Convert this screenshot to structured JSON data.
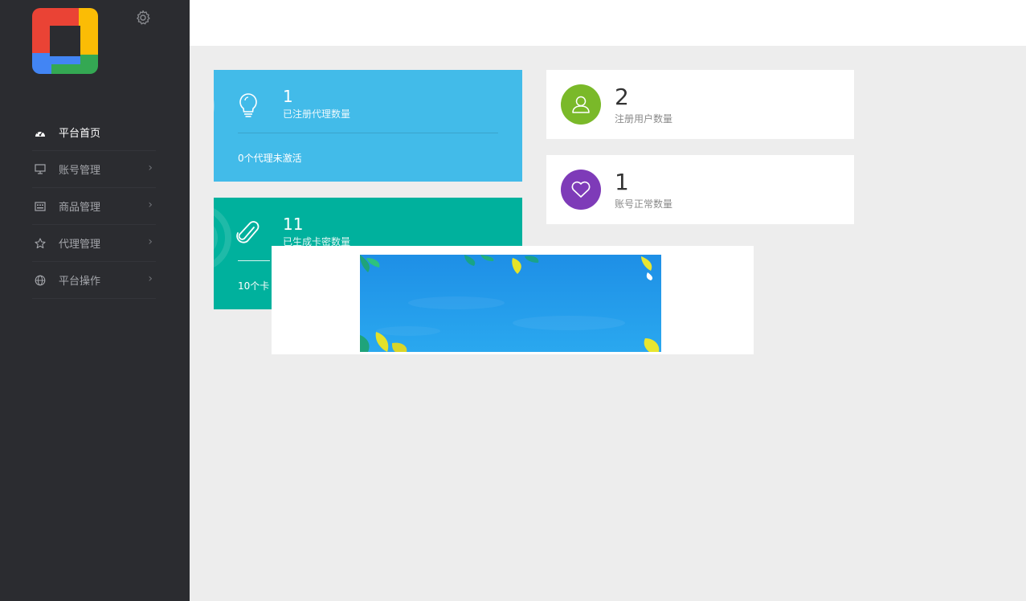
{
  "sidebar": {
    "logo_icon": "four-color-square-logo",
    "settings_icon": "gear-icon",
    "items": [
      {
        "label": "平台首页",
        "icon": "dashboard-icon",
        "active": true,
        "has_arrow": false
      },
      {
        "label": "账号管理",
        "icon": "monitor-icon",
        "active": false,
        "has_arrow": true
      },
      {
        "label": "商品管理",
        "icon": "keyboard-icon",
        "active": false,
        "has_arrow": true
      },
      {
        "label": "代理管理",
        "icon": "star-icon",
        "active": false,
        "has_arrow": true
      },
      {
        "label": "平台操作",
        "icon": "globe-icon",
        "active": false,
        "has_arrow": true
      }
    ],
    "arrow_glyph": "›"
  },
  "cards": {
    "agents": {
      "number": "1",
      "label": "已注册代理数量",
      "footer": "0个代理未激活",
      "color": "#42bbe9",
      "icon": "lightbulb-icon"
    },
    "cardkeys": {
      "number": "11",
      "label": "已生成卡密数量",
      "footer": "10个卡",
      "color": "#00b19d",
      "icon": "paperclip-icon"
    }
  },
  "stats": {
    "users": {
      "number": "2",
      "label": "注册用户数量",
      "color": "#7ab929",
      "icon": "user-icon"
    },
    "normal_accounts": {
      "number": "1",
      "label": "账号正常数量",
      "color": "#7e3bb8",
      "icon": "heart-icon"
    }
  },
  "popup": {
    "banner_colors": [
      "#1e93e8",
      "#2aa4ee"
    ],
    "banner_icon": "sky-with-leaves-image"
  }
}
